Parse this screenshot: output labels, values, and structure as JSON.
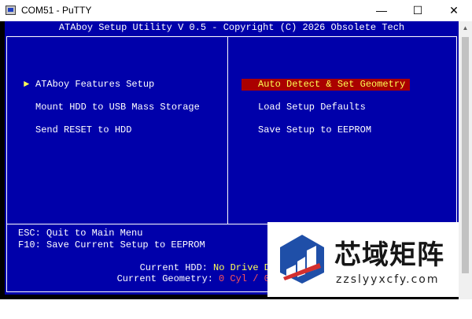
{
  "window": {
    "title": "COM51 - PuTTY",
    "app_icon": "putty-icon",
    "minimize_glyph": "—",
    "maximize_glyph": "☐",
    "close_glyph": "✕"
  },
  "scrollbar": {
    "up_arrow_glyph": "▲"
  },
  "bios": {
    "title": "ATAboy Setup Utility V 0.5 - Copyright (C) 2026 Obsolete Tech",
    "colors": {
      "background": "#0000aa",
      "text": "#ffffff",
      "highlight": "#ffff55",
      "selection": "#aa0000",
      "red": "#ff5555"
    },
    "left_menu": {
      "pointer_glyph": "►",
      "items": [
        {
          "label": "ATAboy Features Setup"
        },
        {
          "label": "Mount HDD to USB Mass Storage"
        },
        {
          "label": "Send RESET to HDD"
        }
      ]
    },
    "right_menu": {
      "items": [
        {
          "label": "Auto Detect & Set Geometry",
          "selected": true
        },
        {
          "label": "Load Setup Defaults"
        },
        {
          "label": "Save Setup to EEPROM"
        }
      ]
    },
    "help_lines": [
      "ESC: Quit to Main Menu",
      "F10: Save Current Setup to EEPROM"
    ],
    "status": {
      "current_hdd_label": "Current HDD:",
      "current_hdd_value": "No Drive D",
      "current_geometry_label": "Current Geometry:",
      "current_geometry_value": "0 Cyl / 0"
    }
  },
  "watermark": {
    "title": "芯域矩阵",
    "url": "zzslyyxcfy.com"
  }
}
